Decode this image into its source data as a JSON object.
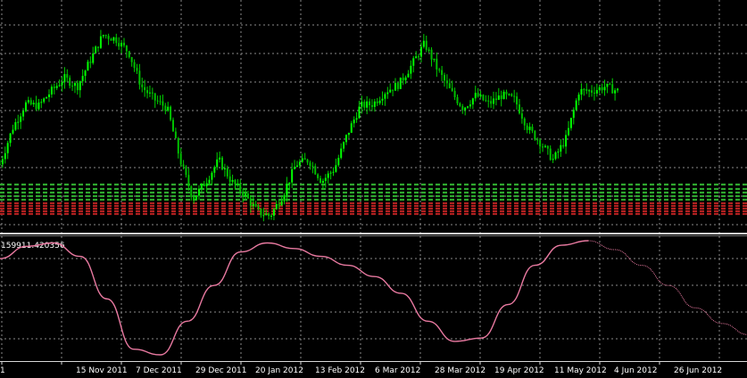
{
  "window": {
    "title": ""
  },
  "colors": {
    "background": "#000000",
    "grid": "#8a8a8a",
    "candle_up": "#00ff00",
    "candle_down": "#00c000",
    "wick": "#00d000",
    "level_green": "#2ea82e",
    "level_red": "#b02020",
    "oscillator_line": "#e879a0",
    "separator": "#d8d8d8",
    "text": "#ffffff"
  },
  "chart_data": [
    {
      "type": "candlestick",
      "title": "",
      "xlabel": "",
      "ylabel": "",
      "grid": true,
      "x_tick_labels": [
        "1",
        "15 Nov 2011",
        "7 Dec 2011",
        "29 Dec 2011",
        "20 Jan 2012",
        "13 Feb 2012",
        "6 Mar 2012",
        "28 Mar 2012",
        "19 Apr 2012",
        "11 May 2012",
        "4 Jun 2012",
        "26 Jun 2012"
      ],
      "close_path": [
        [
          0,
          0.28
        ],
        [
          5,
          0.45
        ],
        [
          10,
          0.56
        ],
        [
          15,
          0.55
        ],
        [
          20,
          0.62
        ],
        [
          25,
          0.68
        ],
        [
          30,
          0.64
        ],
        [
          35,
          0.76
        ],
        [
          40,
          0.88
        ],
        [
          45,
          0.86
        ],
        [
          50,
          0.8
        ],
        [
          55,
          0.64
        ],
        [
          60,
          0.58
        ],
        [
          65,
          0.54
        ],
        [
          70,
          0.3
        ],
        [
          75,
          0.12
        ],
        [
          80,
          0.2
        ],
        [
          85,
          0.3
        ],
        [
          90,
          0.2
        ],
        [
          95,
          0.14
        ],
        [
          100,
          0.06
        ],
        [
          105,
          0.04
        ],
        [
          110,
          0.14
        ],
        [
          115,
          0.28
        ],
        [
          120,
          0.3
        ],
        [
          125,
          0.2
        ],
        [
          130,
          0.26
        ],
        [
          135,
          0.42
        ],
        [
          140,
          0.55
        ],
        [
          145,
          0.56
        ],
        [
          150,
          0.62
        ],
        [
          155,
          0.65
        ],
        [
          160,
          0.74
        ],
        [
          165,
          0.84
        ],
        [
          170,
          0.72
        ],
        [
          175,
          0.62
        ],
        [
          180,
          0.54
        ],
        [
          185,
          0.6
        ],
        [
          190,
          0.56
        ],
        [
          195,
          0.6
        ],
        [
          200,
          0.58
        ],
        [
          205,
          0.45
        ],
        [
          210,
          0.38
        ],
        [
          215,
          0.3
        ],
        [
          220,
          0.4
        ],
        [
          225,
          0.62
        ],
        [
          230,
          0.62
        ],
        [
          235,
          0.64
        ],
        [
          240,
          0.62
        ]
      ],
      "levels": {
        "green_bands": 5,
        "red_bands": 5
      }
    },
    {
      "type": "line",
      "value_label": "159911.420356",
      "x": [
        0,
        10,
        20,
        30,
        40,
        50,
        60,
        70,
        80,
        90,
        100,
        110,
        120,
        130,
        140,
        150,
        160,
        170,
        180,
        190,
        200,
        210,
        220,
        230,
        240,
        250,
        260,
        270,
        280
      ],
      "y": [
        0.86,
        0.97,
        1.0,
        0.88,
        0.5,
        0.05,
        0.0,
        0.3,
        0.62,
        0.92,
        1.0,
        0.95,
        0.88,
        0.8,
        0.7,
        0.55,
        0.3,
        0.12,
        0.15,
        0.45,
        0.8,
        0.98,
        1.02,
        0.94,
        0.8,
        0.62,
        0.42,
        0.28,
        0.18
      ],
      "grid": true
    }
  ]
}
